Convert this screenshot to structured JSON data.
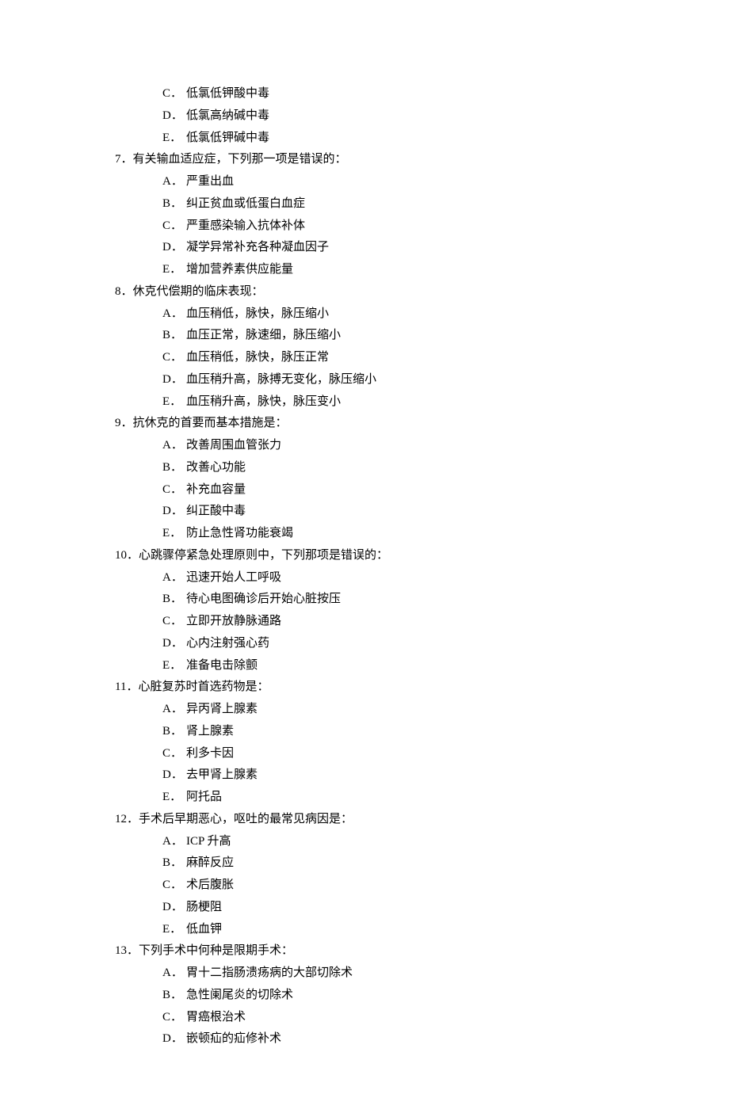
{
  "orphan_options": [
    {
      "letter": "C．",
      "text": "低氯低钾酸中毒"
    },
    {
      "letter": "D．",
      "text": "低氯高纳碱中毒"
    },
    {
      "letter": "E．",
      "text": "低氯低钾碱中毒"
    }
  ],
  "questions": [
    {
      "number": "7．",
      "stem": "有关输血适应症，下列那一项是错误的：",
      "options": [
        {
          "letter": "A．",
          "text": "严重出血"
        },
        {
          "letter": "B．",
          "text": "纠正贫血或低蛋白血症"
        },
        {
          "letter": "C．",
          "text": "严重感染输入抗体补体"
        },
        {
          "letter": "D．",
          "text": "凝学异常补充各种凝血因子"
        },
        {
          "letter": "E．",
          "text": "增加营养素供应能量"
        }
      ]
    },
    {
      "number": "8．",
      "stem": "休克代偿期的临床表现：",
      "options": [
        {
          "letter": "A．",
          "text": "血压稍低，脉快，脉压缩小"
        },
        {
          "letter": "B．",
          "text": "血压正常，脉速细，脉压缩小"
        },
        {
          "letter": "C．",
          "text": "血压稍低，脉快，脉压正常"
        },
        {
          "letter": "D．",
          "text": "血压稍升高，脉搏无变化，脉压缩小"
        },
        {
          "letter": "E．",
          "text": "血压稍升高，脉快，脉压变小"
        }
      ]
    },
    {
      "number": "9．",
      "stem": "抗休克的首要而基本措施是：",
      "options": [
        {
          "letter": "A．",
          "text": "改善周围血管张力"
        },
        {
          "letter": "B．",
          "text": "改善心功能"
        },
        {
          "letter": "C．",
          "text": "补充血容量"
        },
        {
          "letter": "D．",
          "text": "纠正酸中毒"
        },
        {
          "letter": "E．",
          "text": "防止急性肾功能衰竭"
        }
      ]
    },
    {
      "number": "10．",
      "stem": "心跳骤停紧急处理原则中，下列那项是错误的：",
      "options": [
        {
          "letter": "A．",
          "text": "迅速开始人工呼吸"
        },
        {
          "letter": "B．",
          "text": "待心电图确诊后开始心脏按压"
        },
        {
          "letter": "C．",
          "text": "立即开放静脉通路"
        },
        {
          "letter": "D．",
          "text": "心内注射强心药"
        },
        {
          "letter": "E．",
          "text": "准备电击除颤"
        }
      ]
    },
    {
      "number": "11．",
      "stem": "心脏复苏时首选药物是：",
      "options": [
        {
          "letter": "A．",
          "text": "异丙肾上腺素"
        },
        {
          "letter": "B．",
          "text": "肾上腺素"
        },
        {
          "letter": "C．",
          "text": "利多卡因"
        },
        {
          "letter": "D．",
          "text": "去甲肾上腺素"
        },
        {
          "letter": "E．",
          "text": "阿托品"
        }
      ]
    },
    {
      "number": "12．",
      "stem": "手术后早期恶心，呕吐的最常见病因是：",
      "options": [
        {
          "letter": "A．",
          "text": "ICP 升高"
        },
        {
          "letter": "B．",
          "text": "麻醉反应"
        },
        {
          "letter": "C．",
          "text": "术后腹胀"
        },
        {
          "letter": "D．",
          "text": "肠梗阻"
        },
        {
          "letter": "E．",
          "text": "低血钾"
        }
      ]
    },
    {
      "number": "13．",
      "stem": "下列手术中何种是限期手术：",
      "options": [
        {
          "letter": "A．",
          "text": "胃十二指肠溃疡病的大部切除术"
        },
        {
          "letter": "B．",
          "text": "急性阑尾炎的切除术"
        },
        {
          "letter": "C．",
          "text": "胃癌根治术"
        },
        {
          "letter": "D．",
          "text": "嵌顿疝的疝修补术"
        }
      ]
    }
  ]
}
